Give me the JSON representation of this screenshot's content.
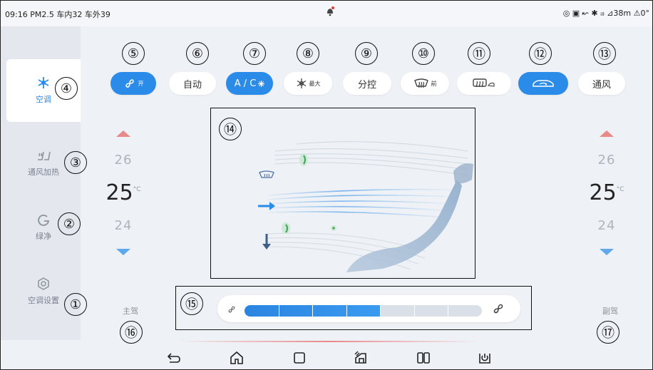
{
  "status": {
    "time": "09:16",
    "pm25": "PM2.5",
    "inside": "车内32",
    "outside": "车外39",
    "right": "◎ ▣ ↜ ✱ ᵢₗₗ ⊿38m ⚠0°"
  },
  "sidebar": {
    "items": [
      {
        "label": "空调",
        "icon": "ac-snowflake-icon",
        "active": true
      },
      {
        "label": "通风加热",
        "icon": "seat-heat-icon",
        "active": false
      },
      {
        "label": "绿净",
        "icon": "green-clean-icon",
        "active": false
      },
      {
        "label": "空调设置",
        "icon": "settings-hex-icon",
        "active": false
      }
    ]
  },
  "buttons": {
    "fan_on": "开",
    "auto": "自动",
    "ac": "A / C",
    "max_cool": "最大",
    "dual": "分控",
    "front_defrost": "前",
    "rear_defrost": "",
    "recirc": "",
    "vent": "通风"
  },
  "driver": {
    "temp_up": "26",
    "temp_current": "25",
    "unit": "°C",
    "temp_down": "24",
    "label": "主驾"
  },
  "passenger": {
    "temp_up": "26",
    "temp_current": "25",
    "unit": "°C",
    "temp_down": "24",
    "label": "副驾"
  },
  "fan": {
    "level": 4,
    "max": 7
  },
  "callouts": [
    "①",
    "②",
    "③",
    "④",
    "⑤",
    "⑥",
    "⑦",
    "⑧",
    "⑨",
    "⑩",
    "⑪",
    "⑫",
    "⑬",
    "⑭",
    "⑮",
    "⑯",
    "⑰"
  ],
  "colors": {
    "accent": "#2a8be8",
    "up_arrow": "#e98a8a",
    "down_arrow": "#5fa8ec"
  }
}
